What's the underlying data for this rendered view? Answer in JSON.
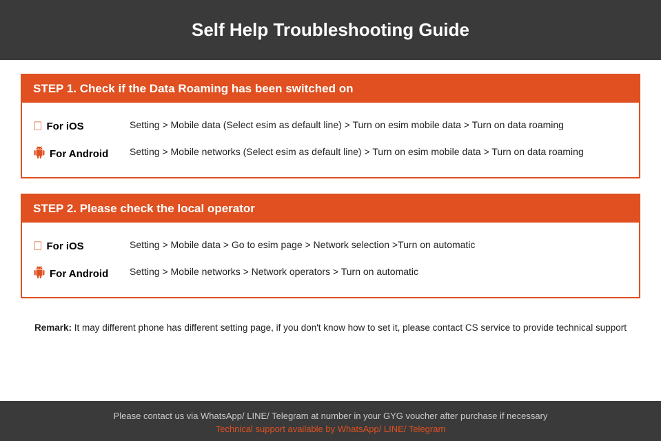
{
  "header": {
    "title": "Self Help Troubleshooting Guide"
  },
  "step1": {
    "heading": "STEP 1.  Check if the Data Roaming has been switched on",
    "ios_label": "For iOS",
    "ios_desc": "Setting > Mobile data (Select esim as default line) > Turn on esim mobile data > Turn on data roaming",
    "android_label": "For Android",
    "android_desc": "Setting > Mobile networks (Select esim as default line) > Turn on esim mobile data > Turn on data roaming"
  },
  "step2": {
    "heading": "STEP 2.  Please check the local operator",
    "ios_label": "For iOS",
    "ios_desc": "Setting > Mobile data > Go to esim page > Network selection >Turn on automatic",
    "android_label": "For Android",
    "android_desc": "Setting > Mobile networks > Network operators > Turn on automatic"
  },
  "remark": {
    "label": "Remark:",
    "text": " It may different phone has different setting page, if you don't know how to set it,  please contact CS service to provide technical support"
  },
  "footer": {
    "contact_text": "Please contact us via WhatsApp/ LINE/ Telegram at number in your GYG voucher after purchase if necessary",
    "support_text": "Technical support available by WhatsApp/ LINE/ Telegram"
  }
}
